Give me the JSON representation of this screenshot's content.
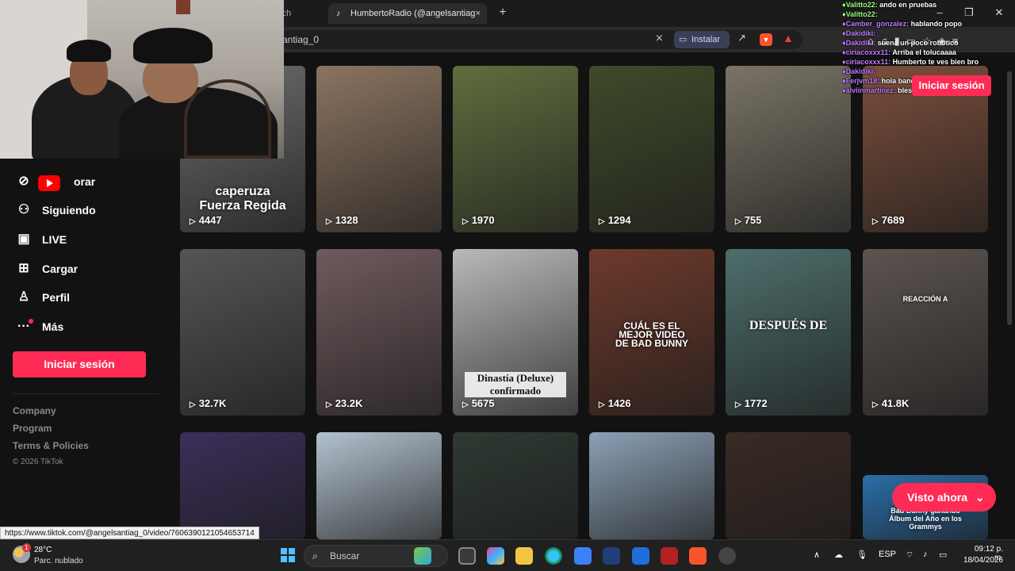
{
  "browser": {
    "prev_tab_label": "rch",
    "active_tab_label": "HumbertoRadio (@angelsantiag",
    "close_label": "×",
    "new_tab_label": "+",
    "url_text": "antiag_0",
    "install_label": "Instalar"
  },
  "sidebar": {
    "items": [
      {
        "label": "orar",
        "icon": "compass-icon"
      },
      {
        "label": "Siguiendo",
        "icon": "user-follow-icon"
      },
      {
        "label": "LIVE",
        "icon": "tv-icon"
      },
      {
        "label": "Cargar",
        "icon": "plus-square-icon"
      },
      {
        "label": "Perfil",
        "icon": "person-icon"
      },
      {
        "label": "Más",
        "icon": "more-dots-icon"
      }
    ],
    "login_label": "Iniciar sesión",
    "footer_links": [
      "Company",
      "Program",
      "Terms & Policies"
    ],
    "copyright": "© 2026 TikTok"
  },
  "videos": [
    {
      "views": "4447",
      "text": "caperuza\nFuerza Regida",
      "bg": "#6d6d6d"
    },
    {
      "views": "1328",
      "text": "",
      "bg": "#8b7461"
    },
    {
      "views": "1970",
      "text": "",
      "bg": "#5f6e3e"
    },
    {
      "views": "1294",
      "text": "",
      "bg": "#3f4a2a"
    },
    {
      "views": "755",
      "text": "",
      "bg": "#7a7466"
    },
    {
      "views": "7689",
      "text": "",
      "bg": "#7b4f3c"
    },
    {
      "views": "32.7K",
      "text": "",
      "bg": "#555555"
    },
    {
      "views": "23.2K",
      "text": "",
      "bg": "#6f5a5d"
    },
    {
      "views": "5675",
      "text": "Dinastía (Deluxe)\nconfirmado",
      "bg": "#b9b9b9"
    },
    {
      "views": "1426",
      "text": "CUÁL ES EL\nMEJOR VIDEO\nDE BAD BUNNY",
      "bg": "#6d3a2c"
    },
    {
      "views": "1772",
      "text": "DESPUÉS DE",
      "bg": "#4d6e6b"
    },
    {
      "views": "41.8K",
      "text": "REACCIÓN A",
      "bg": "#5c5450"
    },
    {
      "views": "",
      "text": "",
      "bg": "#3c2f5a"
    },
    {
      "views": "",
      "text": "",
      "bg": "#b3c2cf"
    },
    {
      "views": "",
      "text": "",
      "bg": "#2f3a33"
    },
    {
      "views": "",
      "text": "",
      "bg": "#8ca0b5"
    },
    {
      "views": "",
      "text": "",
      "bg": "#3a2a24"
    },
    {
      "views": "",
      "text": "Bad Bunny ganando\nÁlbum del Año en los\nGrammys",
      "bg": "#2b6ea8"
    }
  ],
  "chat": [
    {
      "user": "Valitto22:",
      "msg": "ando en pruebas",
      "color": "green"
    },
    {
      "user": "Valitto22:",
      "msg": "",
      "color": "green"
    },
    {
      "user": "Camber_gonzalez:",
      "msg": "hablando popo",
      "color": "purple"
    },
    {
      "user": "Dakidiki:",
      "msg": "",
      "color": "purple"
    },
    {
      "user": "Dakidiki:",
      "msg": "suena un poco robótico",
      "color": "purple"
    },
    {
      "user": "ciriacoxxx11:",
      "msg": "Arriba el tolucaaaa",
      "color": "purple"
    },
    {
      "user": "ciriacoxxx11:",
      "msg": "Humberto te ves bien bro",
      "color": "purple"
    },
    {
      "user": "Dakidiki:",
      "msg": "",
      "color": "purple"
    },
    {
      "user": "Ferjvm18:",
      "msg": "hola bandaaa",
      "color": "purple"
    },
    {
      "user": "alviinmartinez:",
      "msg": "blessed!!!!!!!",
      "color": "purple"
    }
  ],
  "top_login_label": "Iniciar sesión",
  "visto_label": "Visto ahora",
  "status_url": "https://www.tiktok.com/@angelsantiag_0/video/7606390121054653714",
  "taskbar": {
    "temp": "28°C",
    "condition": "Parc. nublado",
    "weather_badge": "1",
    "search_label": "Buscar",
    "language": "ESP",
    "time": "09:12 p. m.",
    "date": "18/04/2026"
  },
  "colors": {
    "brand_pink": "#fe2c55",
    "background": "#121212"
  }
}
